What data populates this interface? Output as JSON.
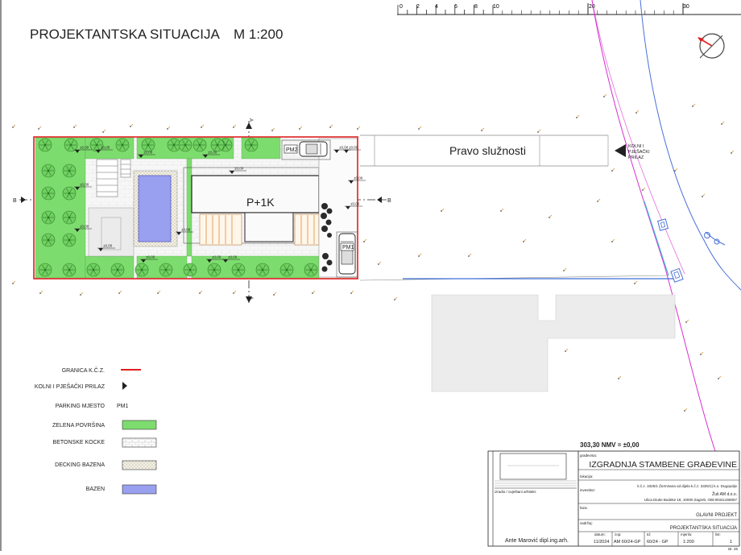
{
  "drawing": {
    "title": "PROJEKTANTSKA SITUACIJA",
    "scale": "M 1:200",
    "ruler_labels": [
      "0",
      "2",
      "4",
      "6",
      "8",
      "10",
      "20",
      "30"
    ],
    "building_label": "P+1K",
    "easement_label": "Pravo služnosti",
    "access_label_line1": "KOLNI I",
    "access_label_line2": "PJEŠAČKI",
    "access_label_line3": "PRILAZ",
    "parking_1": "PM1",
    "parking_2": "PM2",
    "section_a": "A",
    "section_b": "B",
    "elevation_mark": "±0,00",
    "elevation_note": "303,30  NMV = ±0,00",
    "colors": {
      "boundary": "#e02020",
      "green": "#7ddc6e",
      "pool": "#9aa0f0",
      "tree": "#3d9a36",
      "road_magenta": "#d82fd0",
      "road_blue": "#4a6fd8"
    }
  },
  "legend": {
    "items": [
      {
        "label": "GRANICA K.Č.Z.",
        "type": "line"
      },
      {
        "label": "KOLNI I PJEŠAČKI PRILAZ",
        "type": "arrow"
      },
      {
        "label": "PARKING MJESTO",
        "type": "text",
        "symbol": "PM1"
      },
      {
        "label": "ZELENA POVRŠINA",
        "type": "green"
      },
      {
        "label": "BETONSKE KOCKE",
        "type": "concrete"
      },
      {
        "label": "DECKING BAZENA",
        "type": "decking"
      },
      {
        "label": "BAZEN",
        "type": "pool"
      }
    ]
  },
  "titleblock": {
    "created_by_label": "izradio / ovještani arhitekt:",
    "architect": "Ante Marović dipl.ing.arh.",
    "gradjevina_label": "građevina:",
    "project_name": "IZGRADNJA STAMBENE GRAĐEVINE",
    "lokacija_label": "lokacija:",
    "location": "k.č.z. 3325/1 (formirana od dijela k.č.z. 3325/1) k.o. Dugopolje",
    "investitor_label": "investitor:",
    "investor_name": "Žuti AM d.o.o.",
    "investor_address": "Ulica Diuke Budeke 18, 10000 Zagreb, OIB:90341459057",
    "faza_label": "faza:",
    "phase": "GLAVNI PROJEKT",
    "sadrzaj_label": "sadržaj:",
    "content": "PROJEKTANTSKA SITUACIJA",
    "datum_label": "datum:",
    "zop_label": "zop:",
    "td_label": "td:",
    "mjerilo_label": "mjerilo:",
    "list_label": "list:",
    "date": "11/2024",
    "zop": "AM 60/24-GP",
    "td": "60/24 - GP",
    "mjerilo": "1:200",
    "list": "1",
    "page_no": "str. 26"
  }
}
